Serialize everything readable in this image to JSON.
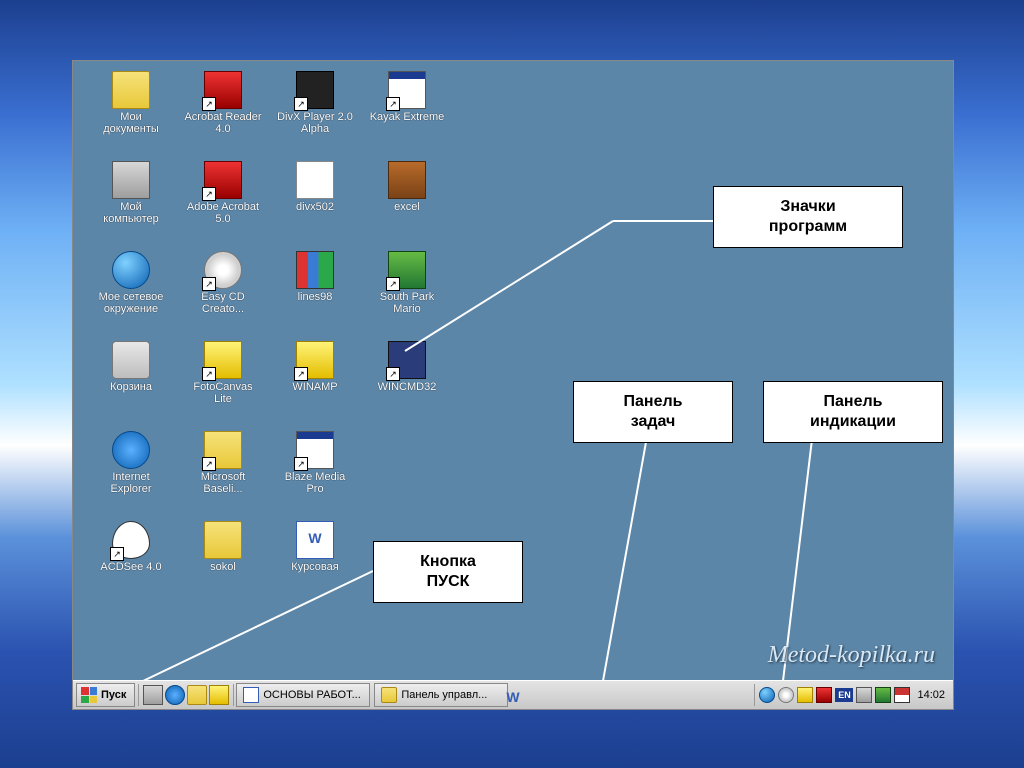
{
  "icons": [
    [
      {
        "name": "my-documents",
        "label": "Мои документы",
        "kind": "folder",
        "shortcut": false
      },
      {
        "name": "acrobat-reader",
        "label": "Acrobat Reader 4.0",
        "kind": "red",
        "shortcut": true
      },
      {
        "name": "divx-player",
        "label": "DivX Player 2.0 Alpha",
        "kind": "dark",
        "shortcut": true
      },
      {
        "name": "kayak-extreme",
        "label": "Kayak Extreme",
        "kind": "win",
        "shortcut": true
      }
    ],
    [
      {
        "name": "my-computer",
        "label": "Мой компьютер",
        "kind": "pc",
        "shortcut": false
      },
      {
        "name": "adobe-acrobat",
        "label": "Adobe Acrobat 5.0",
        "kind": "red",
        "shortcut": true
      },
      {
        "name": "divx502",
        "label": "divx502",
        "kind": "page",
        "shortcut": false
      },
      {
        "name": "excel",
        "label": "excel",
        "kind": "rar",
        "shortcut": false
      }
    ],
    [
      {
        "name": "network-places",
        "label": "Мое сетевое окружение",
        "kind": "globe",
        "shortcut": false
      },
      {
        "name": "easy-cd",
        "label": "Easy CD Creato...",
        "kind": "disc",
        "shortcut": true
      },
      {
        "name": "lines98",
        "label": "lines98",
        "kind": "books",
        "shortcut": false
      },
      {
        "name": "south-park",
        "label": "South Park Mario",
        "kind": "sp",
        "shortcut": true
      }
    ],
    [
      {
        "name": "recycle-bin",
        "label": "Корзина",
        "kind": "bin",
        "shortcut": false
      },
      {
        "name": "fotocanvas",
        "label": "FotoCanvas Lite",
        "kind": "flash",
        "shortcut": true
      },
      {
        "name": "winamp",
        "label": "WINAMP",
        "kind": "flash",
        "shortcut": true
      },
      {
        "name": "wincmd32",
        "label": "WINCMD32",
        "kind": "floppy",
        "shortcut": true
      }
    ],
    [
      {
        "name": "internet-explorer",
        "label": "Internet Explorer",
        "kind": "ie",
        "shortcut": false
      },
      {
        "name": "ms-baseli",
        "label": "Microsoft Baseli...",
        "kind": "key",
        "shortcut": true
      },
      {
        "name": "blaze-media",
        "label": "Blaze Media Pro",
        "kind": "win",
        "shortcut": true
      }
    ],
    [
      {
        "name": "acdsee",
        "label": "ACDSee 4.0",
        "kind": "eye",
        "shortcut": true
      },
      {
        "name": "sokol",
        "label": "sokol",
        "kind": "folder",
        "shortcut": false
      },
      {
        "name": "kursovaya",
        "label": "Курсовая",
        "kind": "word",
        "shortcut": false
      }
    ]
  ],
  "callouts": {
    "programs": "Значки\nпрограмм",
    "taskbar": "Панель\nзадач",
    "tray": "Панель\nиндикации",
    "start": "Кнопка\nПУСК"
  },
  "taskbar": {
    "start": "Пуск",
    "task1": "ОСНОВЫ РАБОТ...",
    "task2": "Панель управл...",
    "lang": "EN",
    "clock": "14:02"
  },
  "watermark": "Metod-kopilka.ru"
}
